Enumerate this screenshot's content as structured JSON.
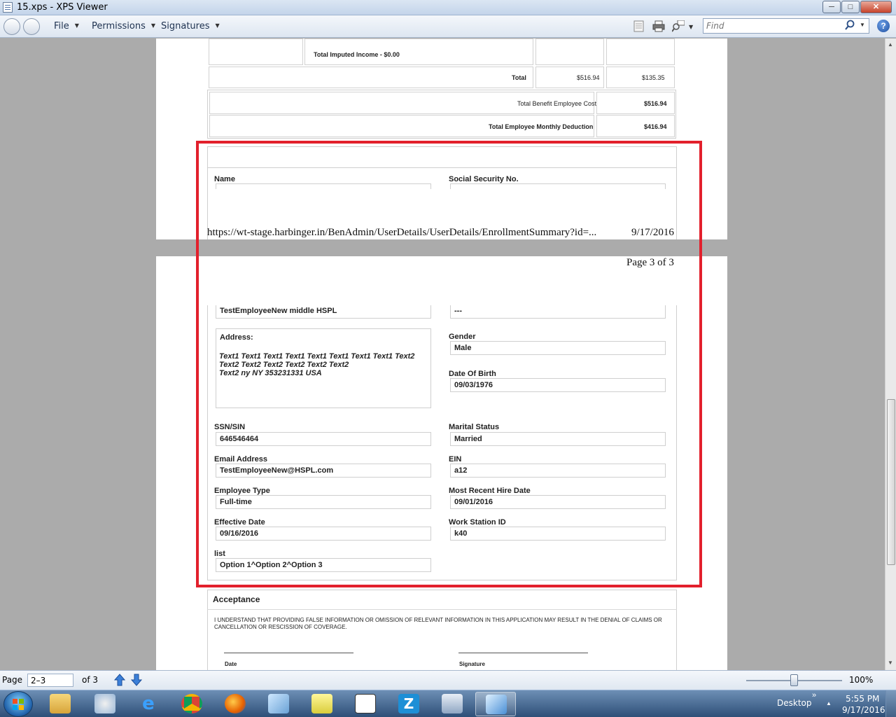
{
  "window": {
    "title": "15.xps - XPS Viewer",
    "minimize_label": "─",
    "maximize_label": "□",
    "close_label": "✕"
  },
  "menu": {
    "file": "File",
    "permissions": "Permissions",
    "signatures": "Signatures",
    "find_placeholder": "Find",
    "help_label": "?"
  },
  "document": {
    "page1": {
      "imputed_income": "Total Imputed Income - $0.00",
      "total_label": "Total",
      "total_employee": "$516.94",
      "total_employer": "$135.35",
      "benefit_cost_label": "Total Benefit Employee Cost",
      "benefit_cost_value": "$516.94",
      "monthly_deduction_label": "Total Employee Monthly Deduction",
      "monthly_deduction_value": "$416.94",
      "name_label": "Name",
      "ssn_label": "Social Security No."
    },
    "footer": {
      "url": "https://wt-stage.harbinger.in/BenAdmin/UserDetails/UserDetails/EnrollmentSummary?id=...",
      "date": "9/17/2016"
    },
    "page_of": "Page 3 of 3",
    "fields": {
      "name_value": "TestEmployeeNew middle HSPL",
      "ssn_top_value": "---",
      "address_label": "Address:",
      "address_value": "Text1 Text1 Text1 Text1 Text1 Text1 Text1 Text1 Text2\nText2 Text2 Text2 Text2 Text2 Text2\nText2 ny NY 353231331 USA",
      "gender_label": "Gender",
      "gender_value": "Male",
      "dob_label": "Date Of Birth",
      "dob_value": "09/03/1976",
      "ssn_sin_label": "SSN/SIN",
      "ssn_sin_value": "646546464",
      "marital_label": "Marital Status",
      "marital_value": "Married",
      "email_label": "Email Address",
      "email_value": "TestEmployeeNew@HSPL.com",
      "ein_label": "EIN",
      "ein_value": "a12",
      "emp_type_label": "Employee Type",
      "emp_type_value": "Full-time",
      "hire_label": "Most Recent Hire Date",
      "hire_value": "09/01/2016",
      "effective_label": "Effective Date",
      "effective_value": "09/16/2016",
      "workstation_label": "Work Station ID",
      "workstation_value": "k40",
      "list_label": "list",
      "list_value": "Option 1^Option 2^Option 3"
    },
    "acceptance": {
      "title": "Acceptance",
      "text": "I UNDERSTAND THAT PROVIDING FALSE INFORMATION OR OMISSION OF RELEVANT INFORMATION IN THIS APPLICATION MAY RESULT IN THE DENIAL OF CLAIMS OR CANCELLATION OR RESCISSION OF COVERAGE.",
      "date_label": "Date",
      "signature_label": "Signature"
    }
  },
  "statusbar": {
    "page_label": "Page",
    "page_value": "2–3",
    "of_label": "of 3",
    "zoom": "100%"
  },
  "taskbar": {
    "desktop_label": "Desktop",
    "chevron": "»",
    "time": "5:55 PM",
    "date": "9/17/2016",
    "z_app_letter": "Z"
  },
  "colors": {
    "highlight": "#e2202c"
  }
}
